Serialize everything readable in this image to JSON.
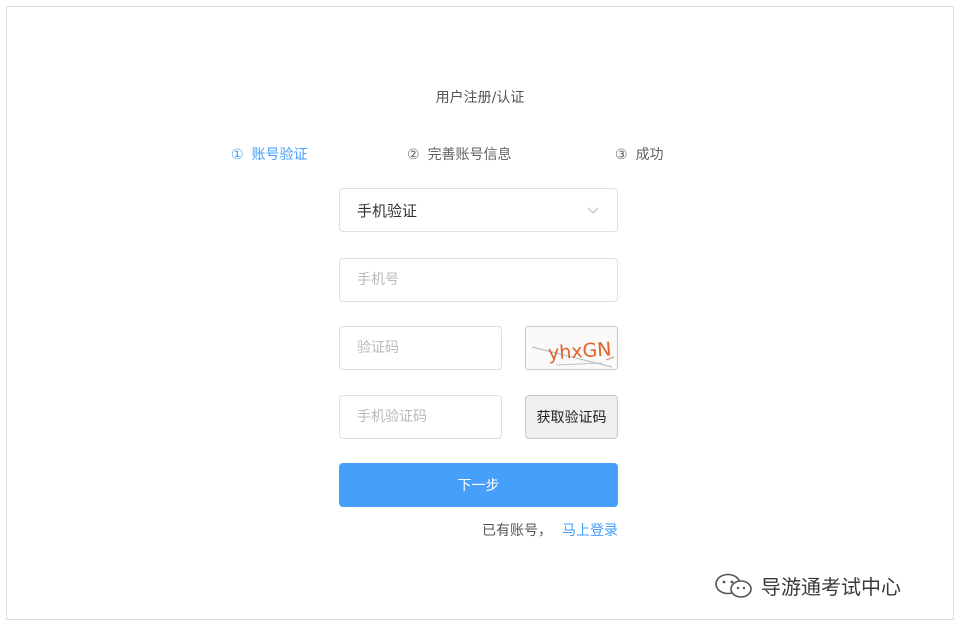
{
  "page": {
    "title": "用户注册/认证"
  },
  "steps": [
    {
      "num": "①",
      "label": "账号验证",
      "active": true
    },
    {
      "num": "②",
      "label": "完善账号信息",
      "active": false
    },
    {
      "num": "③",
      "label": "成功",
      "active": false
    }
  ],
  "form": {
    "method_select": {
      "value": "手机验证"
    },
    "phone": {
      "placeholder": "手机号",
      "value": ""
    },
    "captcha": {
      "placeholder": "验证码",
      "value": "",
      "image_text": "yhxGN"
    },
    "sms_code": {
      "placeholder": "手机验证码",
      "value": ""
    },
    "get_code_label": "获取验证码",
    "next_label": "下一步"
  },
  "footer": {
    "have_account": "已有账号，",
    "login_link": "马上登录"
  },
  "watermark": {
    "text": "导游通考试中心"
  },
  "colors": {
    "accent": "#409eff",
    "button": "#46a0fb"
  }
}
